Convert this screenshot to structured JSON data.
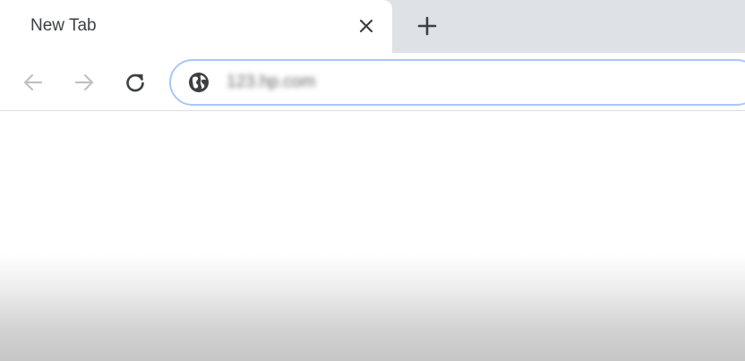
{
  "tab": {
    "title": "New Tab",
    "close_icon": "close-icon"
  },
  "tabstrip": {
    "new_tab_icon": "plus-icon"
  },
  "toolbar": {
    "back_icon": "arrow-left-icon",
    "forward_icon": "arrow-right-icon",
    "reload_icon": "reload-icon"
  },
  "omnibox": {
    "site_icon": "globe-icon",
    "url": "123.hp.com",
    "border_color": "#a8c7fa"
  },
  "colors": {
    "tabstrip_bg": "#dee1e6",
    "tab_bg": "#ffffff",
    "text": "#3c4043",
    "icon_disabled": "#bdc1c6",
    "icon_active": "#3c4043"
  }
}
